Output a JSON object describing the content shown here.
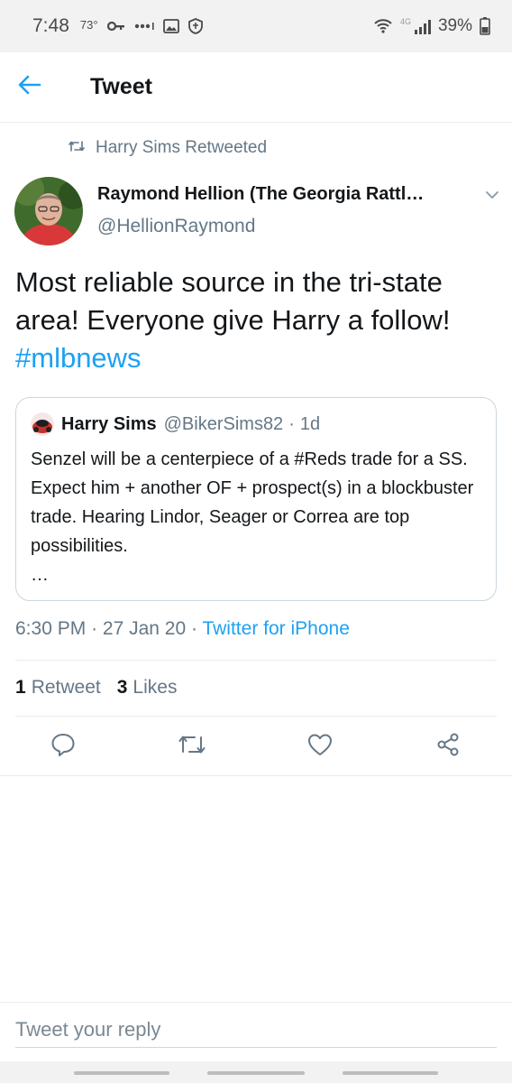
{
  "status_bar": {
    "time": "7:48",
    "temperature": "73°",
    "battery_percent": "39%",
    "network": "4G"
  },
  "header": {
    "title": "Tweet"
  },
  "retweet_context": {
    "text": "Harry Sims Retweeted"
  },
  "tweet": {
    "author_name": "Raymond Hellion (The Georgia Rattl…",
    "author_handle": "@HellionRaymond",
    "text": "Most reliable source in the tri-state area! Everyone give Harry a follow!",
    "hashtag": "#mlbnews",
    "time": "6:30 PM",
    "date": "27 Jan 20",
    "source": "Twitter for iPhone",
    "separator": "·"
  },
  "quoted_tweet": {
    "author_name": "Harry Sims",
    "author_handle": "@BikerSims82",
    "separator": "·",
    "age": "1d",
    "text": "Senzel will be a centerpiece of a #Reds trade for a SS. Expect him + another OF + prospect(s) in a blockbuster trade. Hearing Lindor, Seager or Correa are top possibilities.",
    "more": "…"
  },
  "stats": {
    "retweets_count": "1",
    "retweets_label": "Retweet",
    "likes_count": "3",
    "likes_label": "Likes"
  },
  "reply": {
    "placeholder": "Tweet your reply"
  },
  "colors": {
    "accent": "#1da1f2",
    "secondary_text": "#657786",
    "divider": "#e6ecf0"
  },
  "icons": {
    "back": "back-arrow-icon",
    "retweet": "retweet-icon",
    "caret": "chevron-down-icon",
    "reply": "reply-icon",
    "like": "heart-icon",
    "share": "share-icon"
  }
}
